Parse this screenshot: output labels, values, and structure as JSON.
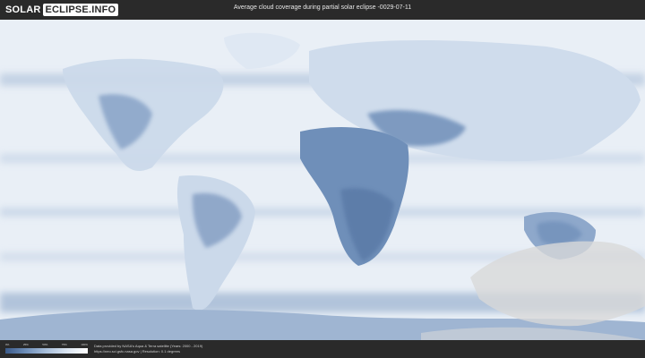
{
  "logo": {
    "part1": "SOLAR",
    "part2": "ECLIPSE.INFO"
  },
  "title": "Average cloud coverage during partial solar eclipse -0029-07-11",
  "legend": {
    "ticks": [
      "0%",
      "25%",
      "50%",
      "75%",
      "100%"
    ],
    "colors": [
      "#3b5a89",
      "#6f8fb9",
      "#a9bfdb",
      "#dbe5f1",
      "#ffffff"
    ]
  },
  "credits": {
    "line1": "Data provided by NASA's Aqua & Terra satellite (Years: 2000 - 2019)",
    "line2": "https://neo.sci.gsfc.nasa.gov | Resolution: 0.1 degrees"
  },
  "map": {
    "eclipse_region_color": "#d9d9d9",
    "land_dark_color": "#5f7ea9",
    "ocean_color": "#e9eff6"
  }
}
